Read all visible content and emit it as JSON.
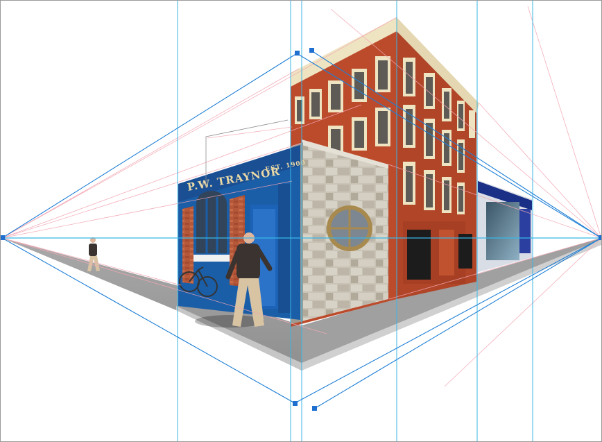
{
  "canvas": {
    "background": "#ffffff",
    "frame_color": "#9a9a9a"
  },
  "perspective": {
    "mode": "two-point perspective",
    "horizon_color": "#39b6e6",
    "guide_color": "#1f7fd6",
    "construction_color": "#f2a6b3",
    "handle_color": "#1e6fd0"
  },
  "storefront": {
    "sign_name": "P.W. TRAYNOR",
    "sign_established": "EST. 1900",
    "sign_color": "#1b5ea8",
    "sign_text_color": "#e9d9a6"
  },
  "brick_building": {
    "wall_color": "#b8492c",
    "window_frame_color": "#efe4c2"
  },
  "annex": {
    "sign_color": "#1a2f86"
  },
  "sidewalk": {
    "color": "#9a9a9a"
  },
  "people": {
    "foreground": "man walking",
    "background": "small walking figure"
  }
}
